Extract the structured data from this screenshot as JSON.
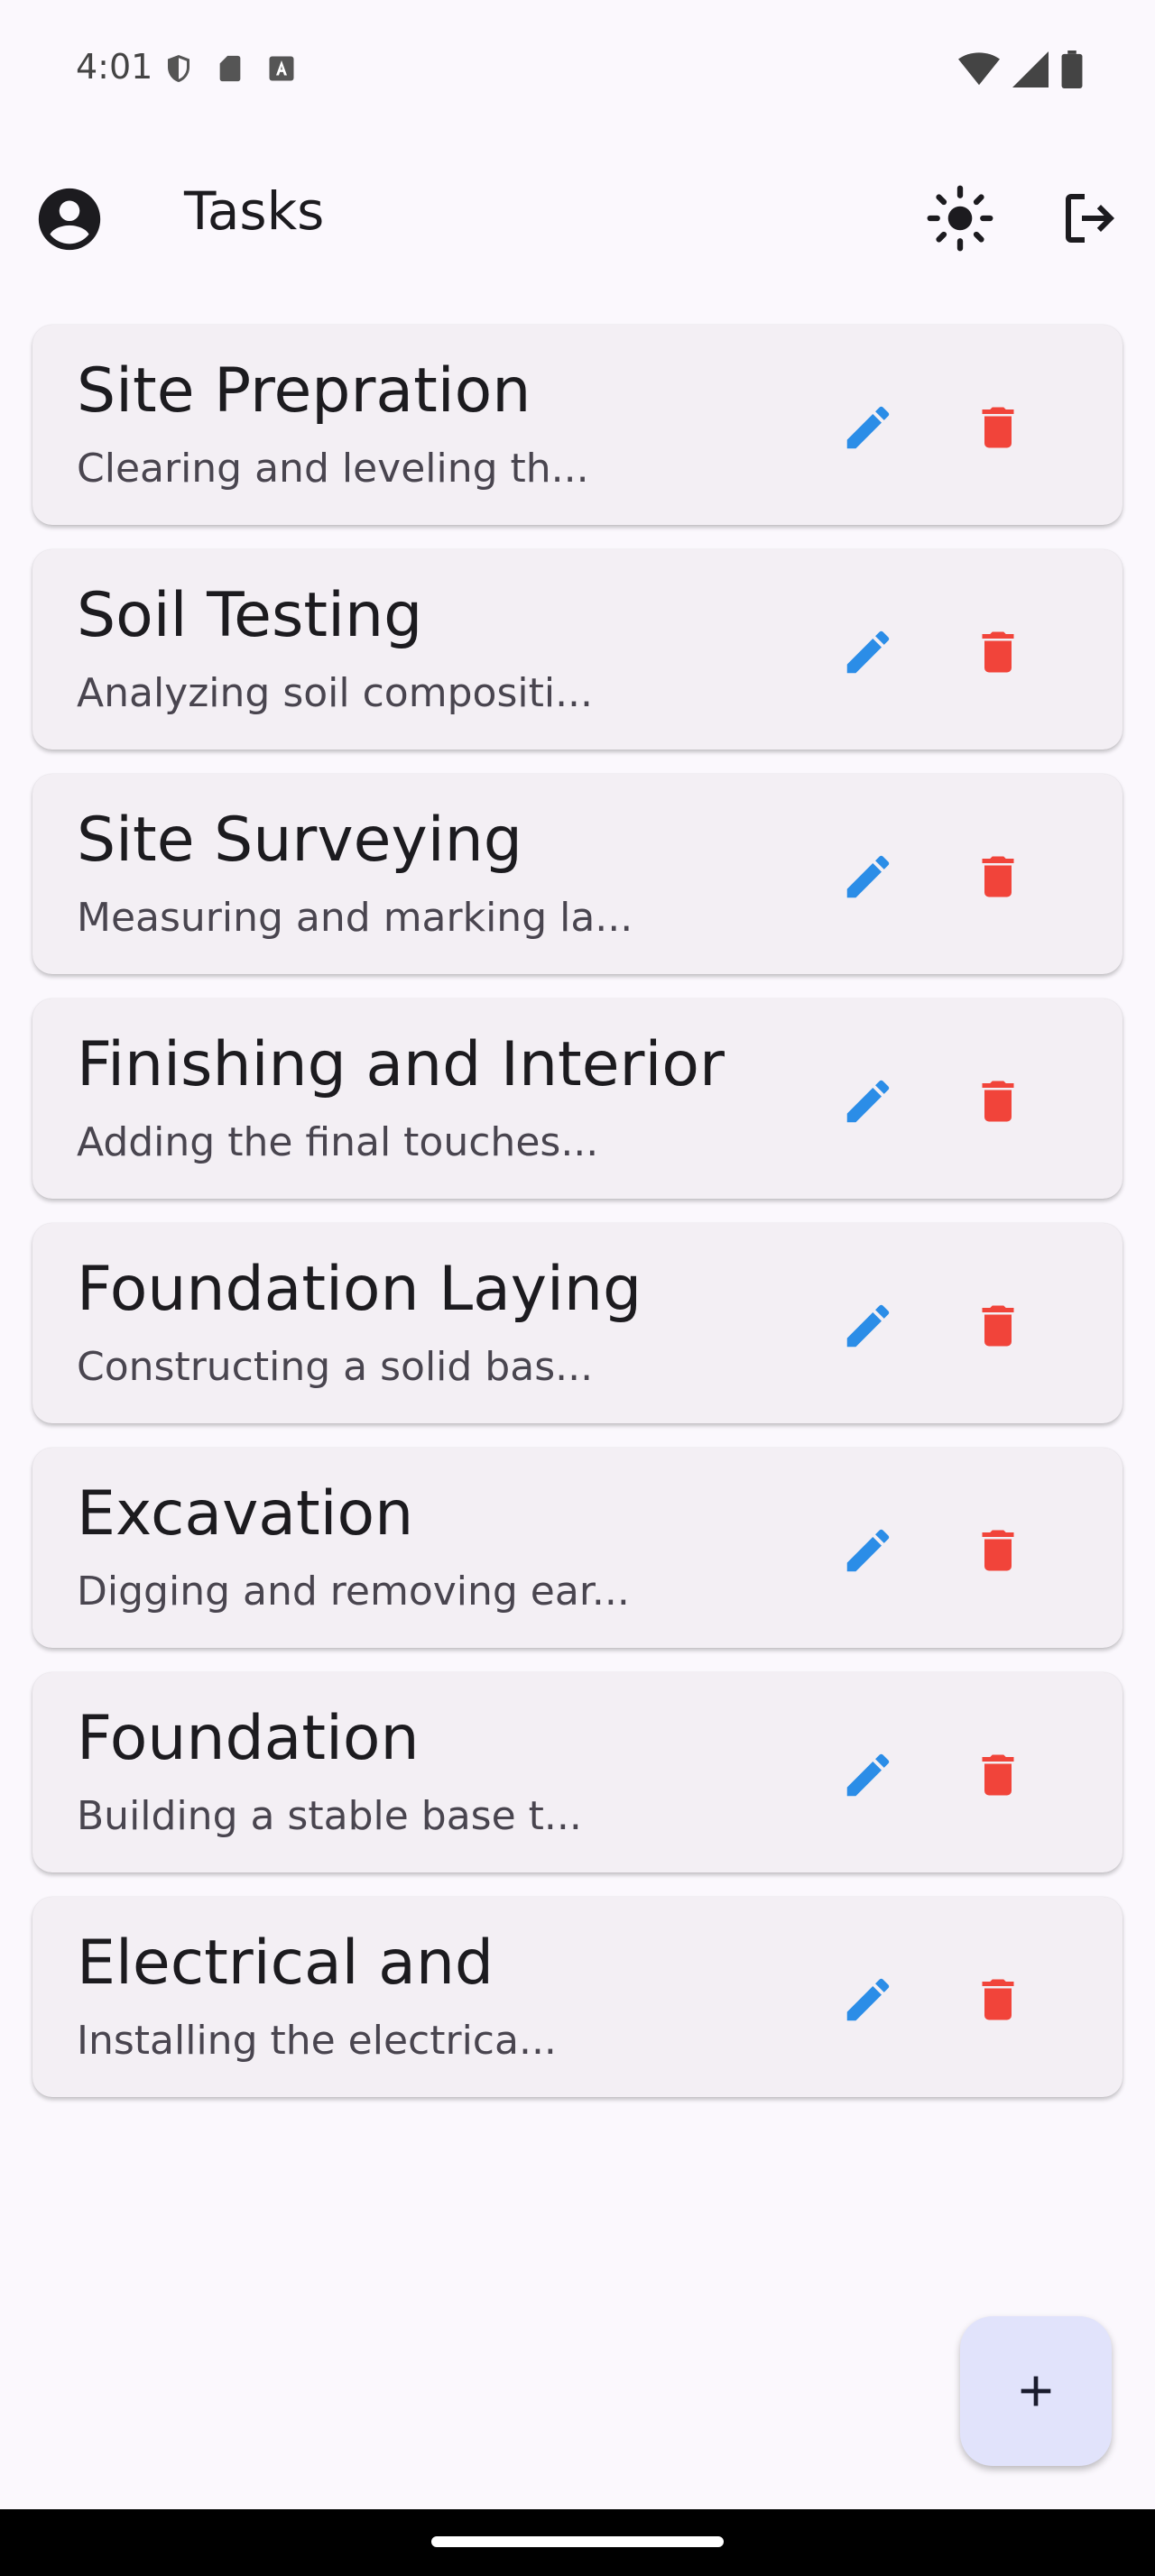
{
  "status_bar": {
    "time": "4:01",
    "left_icons": [
      "shield-icon",
      "sd-card-icon",
      "font-a-icon"
    ],
    "right_icons": [
      "wifi-icon",
      "signal-icon",
      "battery-icon"
    ]
  },
  "app_bar": {
    "title": "Tasks",
    "icons": [
      "account-circle-icon",
      "light-mode-icon",
      "logout-icon"
    ]
  },
  "colors": {
    "background": "#fbf8fd",
    "card": "#f3eff4",
    "edit": "#2b8de7",
    "delete": "#f1443a",
    "fab": "#e1e3fb"
  },
  "tasks": [
    {
      "title": "Site Prepration",
      "description": "Clearing and leveling th..."
    },
    {
      "title": "Soil Testing",
      "description": "Analyzing soil compositi..."
    },
    {
      "title": "Site Surveying",
      "description": "Measuring and marking la..."
    },
    {
      "title": "Finishing and Interior",
      "description": "Adding the final touches..."
    },
    {
      "title": "Foundation Laying",
      "description": "Constructing a solid bas..."
    },
    {
      "title": "Excavation",
      "description": "Digging and removing ear..."
    },
    {
      "title": "Foundation",
      "description": "Building a stable base t..."
    },
    {
      "title": "Electrical and",
      "description": "Installing the electrica..."
    }
  ],
  "fab": {
    "icon": "add-icon"
  }
}
